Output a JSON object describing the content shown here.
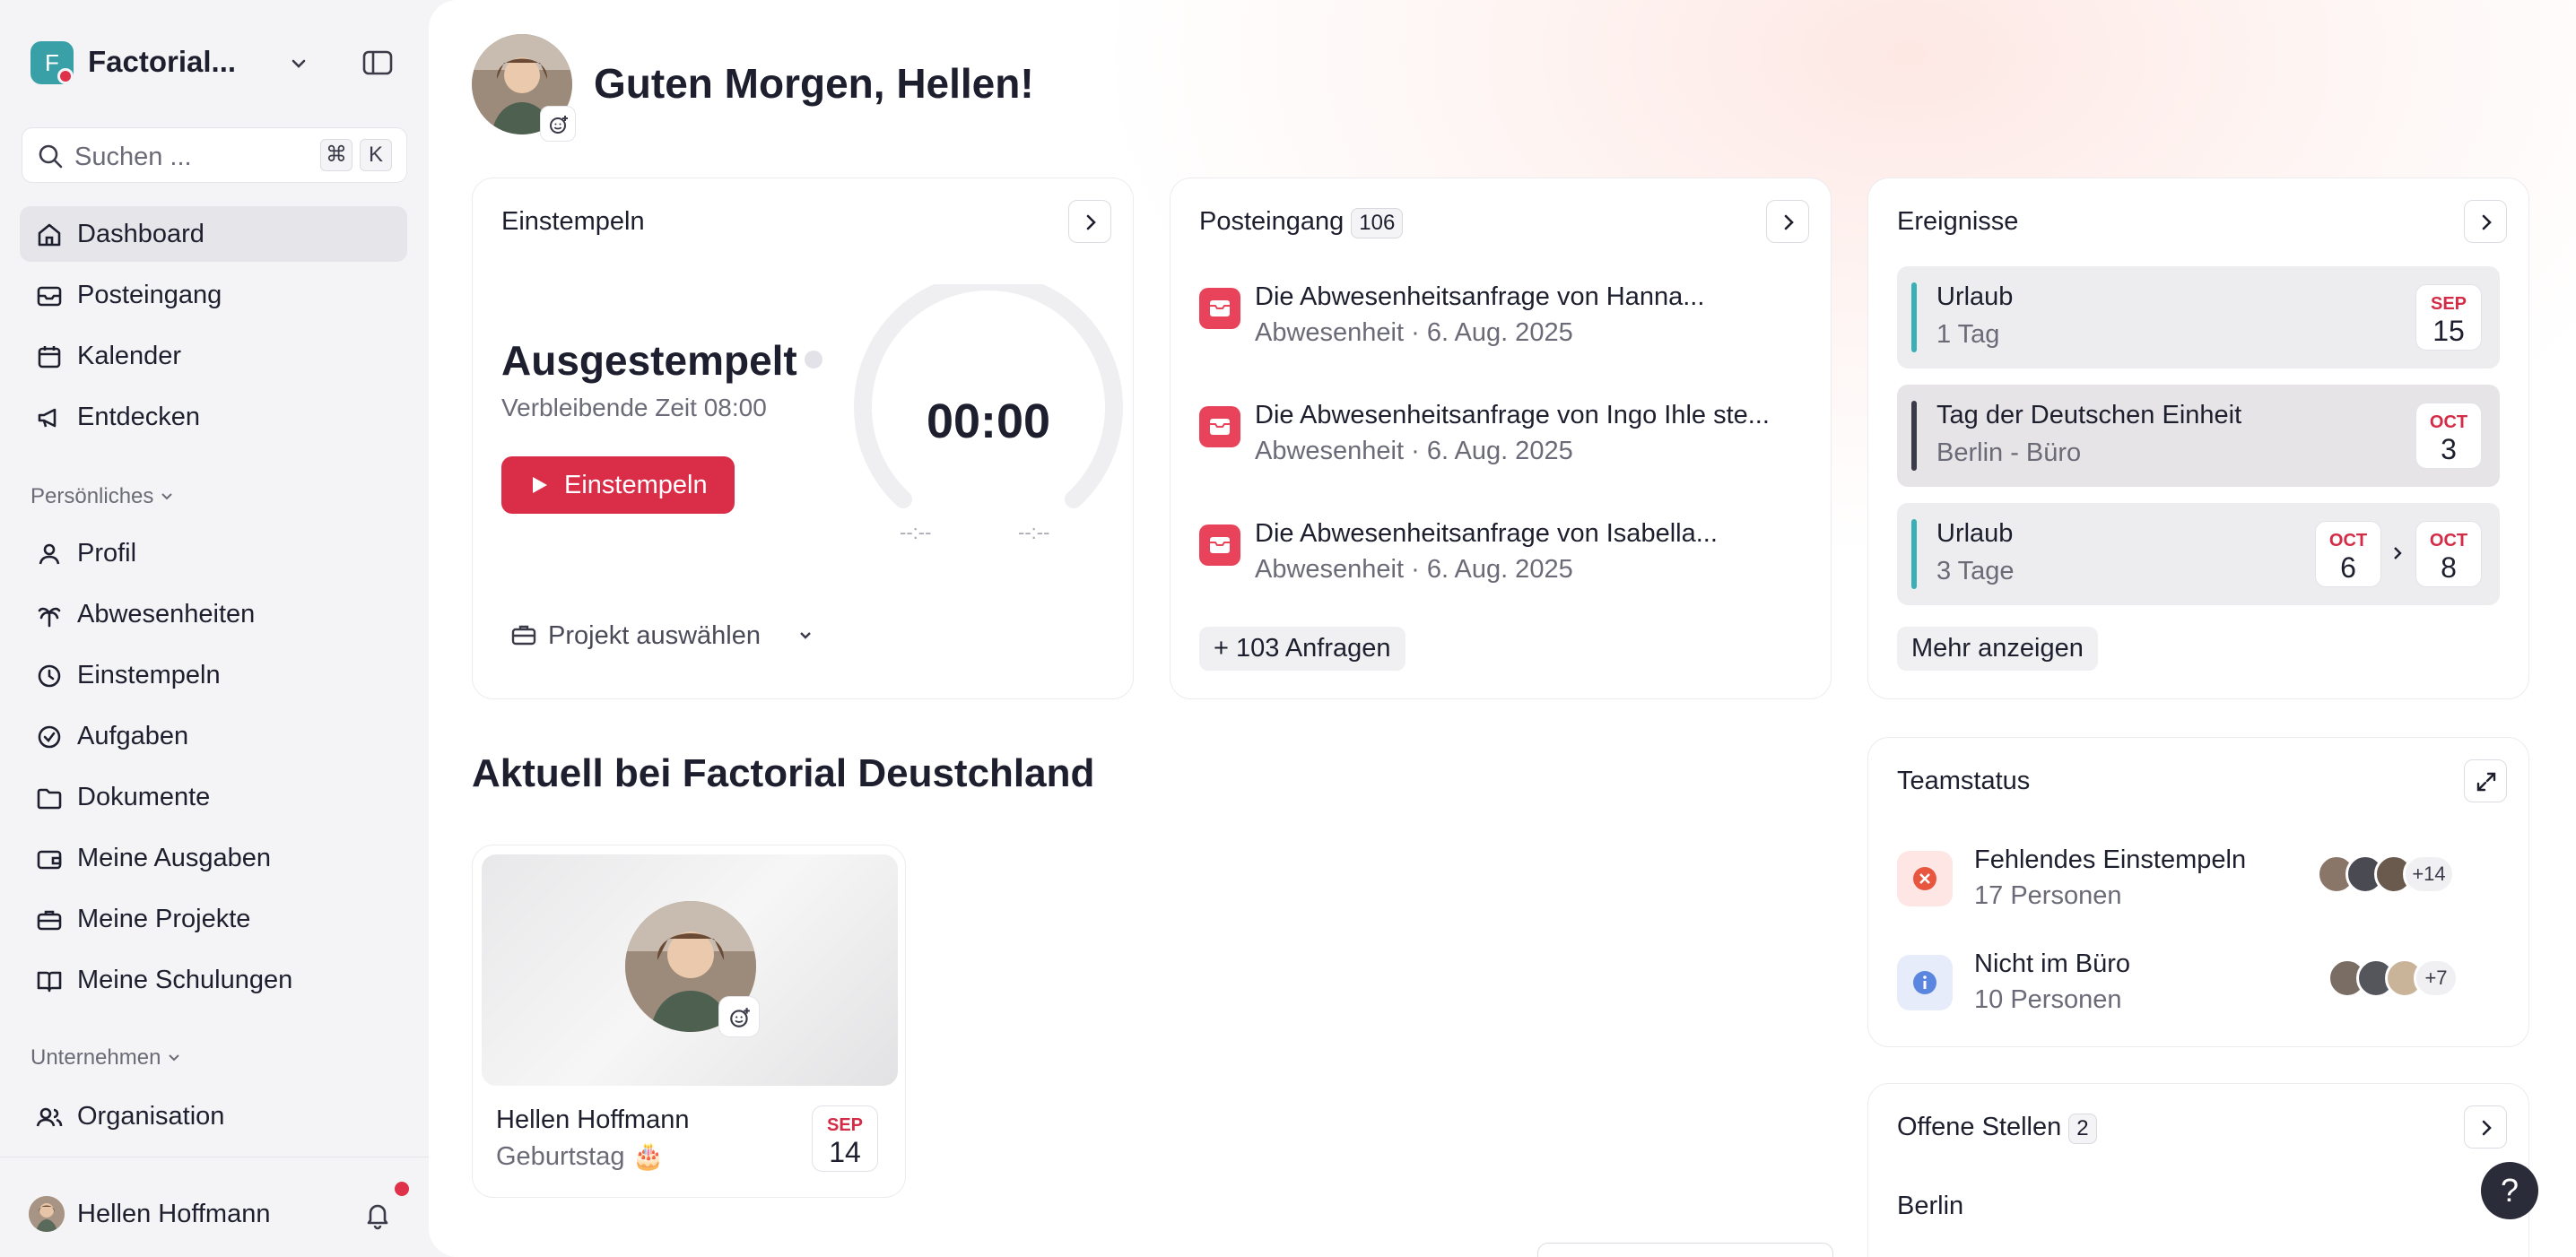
{
  "sidebar": {
    "company": "Factorial...",
    "logo_letter": "F",
    "search_placeholder": "Suchen ...",
    "shortcut_keys": [
      "⌘",
      "K"
    ],
    "nav_main": [
      {
        "label": "Dashboard",
        "icon": "home-icon",
        "active": true
      },
      {
        "label": "Posteingang",
        "icon": "inbox-icon"
      },
      {
        "label": "Kalender",
        "icon": "calendar-icon"
      },
      {
        "label": "Entdecken",
        "icon": "megaphone-icon"
      }
    ],
    "section_personal": "Persönliches",
    "nav_personal": [
      {
        "label": "Profil",
        "icon": "user-icon"
      },
      {
        "label": "Abwesenheiten",
        "icon": "palm-tree-icon"
      },
      {
        "label": "Einstempeln",
        "icon": "clock-icon"
      },
      {
        "label": "Aufgaben",
        "icon": "check-circle-icon"
      },
      {
        "label": "Dokumente",
        "icon": "folder-icon"
      },
      {
        "label": "Meine Ausgaben",
        "icon": "wallet-icon"
      },
      {
        "label": "Meine Projekte",
        "icon": "briefcase-icon"
      },
      {
        "label": "Meine Schulungen",
        "icon": "book-icon"
      }
    ],
    "section_company": "Unternehmen",
    "nav_company": [
      {
        "label": "Organisation",
        "icon": "people-icon"
      }
    ],
    "user_name": "Hellen Hoffmann"
  },
  "header": {
    "greeting": "Guten Morgen, Hellen!"
  },
  "clock_card": {
    "title": "Einstempeln",
    "status": "Ausgestempelt",
    "remaining": "Verbleibende Zeit 08:00",
    "button": "Einstempeln",
    "time": "00:00",
    "start_placeholder": "--:--",
    "end_placeholder": "--:--",
    "project": "Projekt auswählen"
  },
  "inbox_card": {
    "title": "Posteingang",
    "count": "106",
    "items": [
      {
        "title": "Die Abwesenheitsanfrage von Hanna...",
        "subtitle": "Abwesenheit · 6. Aug. 2025"
      },
      {
        "title": "Die Abwesenheitsanfrage von Ingo Ihle ste...",
        "subtitle": "Abwesenheit · 6. Aug. 2025"
      },
      {
        "title": "Die Abwesenheitsanfrage von Isabella...",
        "subtitle": "Abwesenheit · 6. Aug. 2025"
      }
    ],
    "more": "+ 103 Anfragen"
  },
  "events_card": {
    "title": "Ereignisse",
    "events": [
      {
        "title": "Urlaub",
        "subtitle": "1 Tag",
        "month": "SEP",
        "day": "15",
        "color": "#3ab0b5"
      },
      {
        "title": "Tag der Deutschen Einheit",
        "subtitle": "Berlin - Büro",
        "month": "OCT",
        "day": "3",
        "color": "#3a3a48"
      },
      {
        "title": "Urlaub",
        "subtitle": "3 Tage",
        "month": "OCT",
        "day": "6",
        "month2": "OCT",
        "day2": "8",
        "color": "#3ab0b5"
      }
    ],
    "more": "Mehr anzeigen"
  },
  "news": {
    "title": "Aktuell bei Factorial Deustchland",
    "person": "Hellen Hoffmann",
    "occasion": "Geburtstag 🎂",
    "month": "SEP",
    "day": "14"
  },
  "team_card": {
    "title": "Teamstatus",
    "rows": [
      {
        "title": "Fehlendes Einstempeln",
        "subtitle": "17 Personen",
        "extra": "+14"
      },
      {
        "title": "Nicht im Büro",
        "subtitle": "10 Personen",
        "extra": "+7"
      }
    ]
  },
  "jobs_card": {
    "title": "Offene Stellen",
    "count": "2",
    "first_location": "Berlin"
  },
  "help_label": "?"
}
